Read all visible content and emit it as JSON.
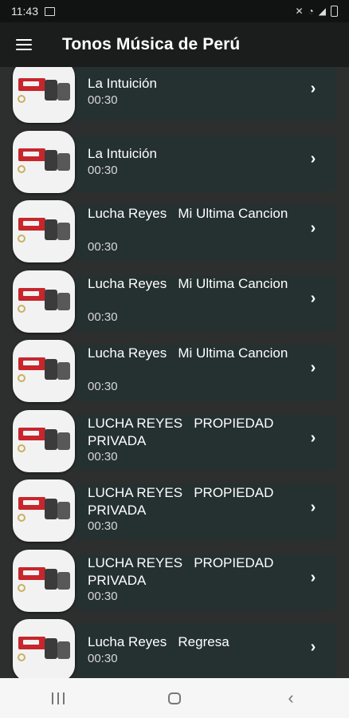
{
  "status_bar": {
    "time": "11:43",
    "left_icons": [
      "gallery-icon"
    ],
    "right_icons": [
      "mute-icon",
      "wifi-icon",
      "signal-icon",
      "battery-icon"
    ]
  },
  "app_bar": {
    "title": "Tonos Música de Perú",
    "menu_icon": "hamburger-menu-icon"
  },
  "songs": [
    {
      "title": "La Intuición",
      "duration": "00:30"
    },
    {
      "title": "La Intuición",
      "duration": "00:30"
    },
    {
      "title": "Lucha Reyes   Mi Ultima Cancion",
      "duration": "00:30"
    },
    {
      "title": "Lucha Reyes   Mi Ultima Cancion",
      "duration": "00:30"
    },
    {
      "title": "Lucha Reyes   Mi Ultima Cancion",
      "duration": "00:30"
    },
    {
      "title": "LUCHA REYES   PROPIEDAD PRIVADA",
      "duration": "00:30"
    },
    {
      "title": "LUCHA REYES   PROPIEDAD PRIVADA",
      "duration": "00:30"
    },
    {
      "title": "LUCHA REYES   PROPIEDAD PRIVADA",
      "duration": "00:30"
    },
    {
      "title": "Lucha Reyes   Regresa",
      "duration": "00:30"
    }
  ],
  "nav_bar": {
    "icons": [
      "recents-icon",
      "home-icon",
      "back-icon"
    ]
  },
  "colors": {
    "background": "#2d2f2e",
    "card": "#253030",
    "app_bar": "#1b1d1c",
    "status_bar": "#111313",
    "nav_bar": "#f6f6f6"
  }
}
